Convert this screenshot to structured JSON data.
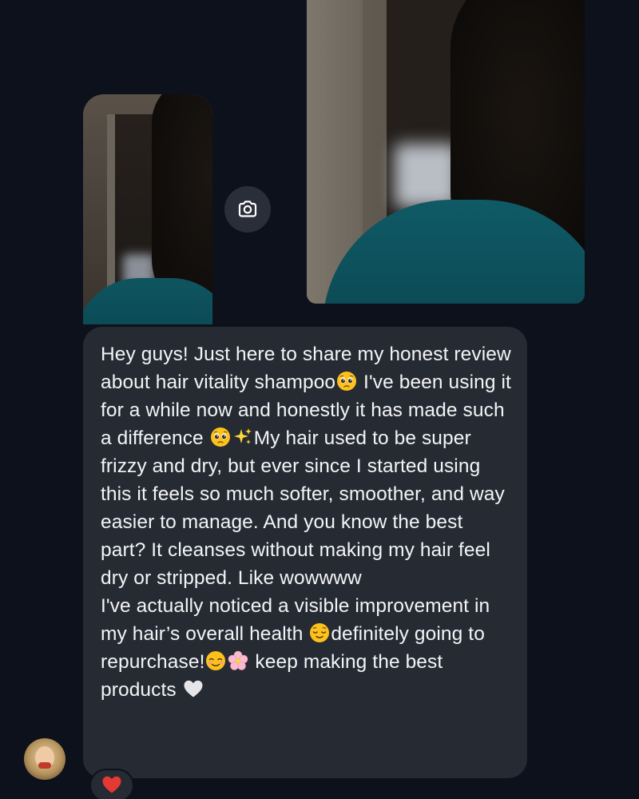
{
  "media": {
    "left_photo_alt": "",
    "right_photo_alt": ""
  },
  "camera_button": {
    "icon": "camera-icon"
  },
  "message": {
    "paragraphs": [
      {
        "segments": [
          {
            "type": "text",
            "text": "Hey guys! Just here to share my honest review about hair vitality shampoo"
          },
          {
            "type": "emoji",
            "name": "pleading-face-emoji"
          },
          {
            "type": "text",
            "text": " I've been using it for a while now and honestly it has made such a difference "
          },
          {
            "type": "emoji",
            "name": "pleading-face-emoji"
          },
          {
            "type": "emoji",
            "name": "sparkles-emoji"
          },
          {
            "type": "text",
            "text": "My hair used to be super frizzy and dry, but ever since I started using this it feels so much softer, smoother, and way easier to manage. And you know the best part? It cleanses without making my hair feel dry or stripped. Like wowwww"
          }
        ]
      },
      {
        "segments": [
          {
            "type": "text",
            "text": "I've actually noticed a visible improvement in my hair’s overall health "
          },
          {
            "type": "emoji",
            "name": "relieved-face-emoji"
          },
          {
            "type": "text",
            "text": "definitely going to repurchase!"
          },
          {
            "type": "emoji",
            "name": "smiling-face-emoji"
          },
          {
            "type": "emoji",
            "name": "cherry-blossom-emoji"
          },
          {
            "type": "text",
            "text": " keep making the best products "
          },
          {
            "type": "emoji",
            "name": "white-heart-emoji"
          }
        ]
      }
    ]
  },
  "reaction": {
    "icon": "red-heart-icon"
  },
  "colors": {
    "background": "#0d111b",
    "bubble": "#262a33",
    "text": "#f3f4f6",
    "accent_heart": "#e53935"
  }
}
